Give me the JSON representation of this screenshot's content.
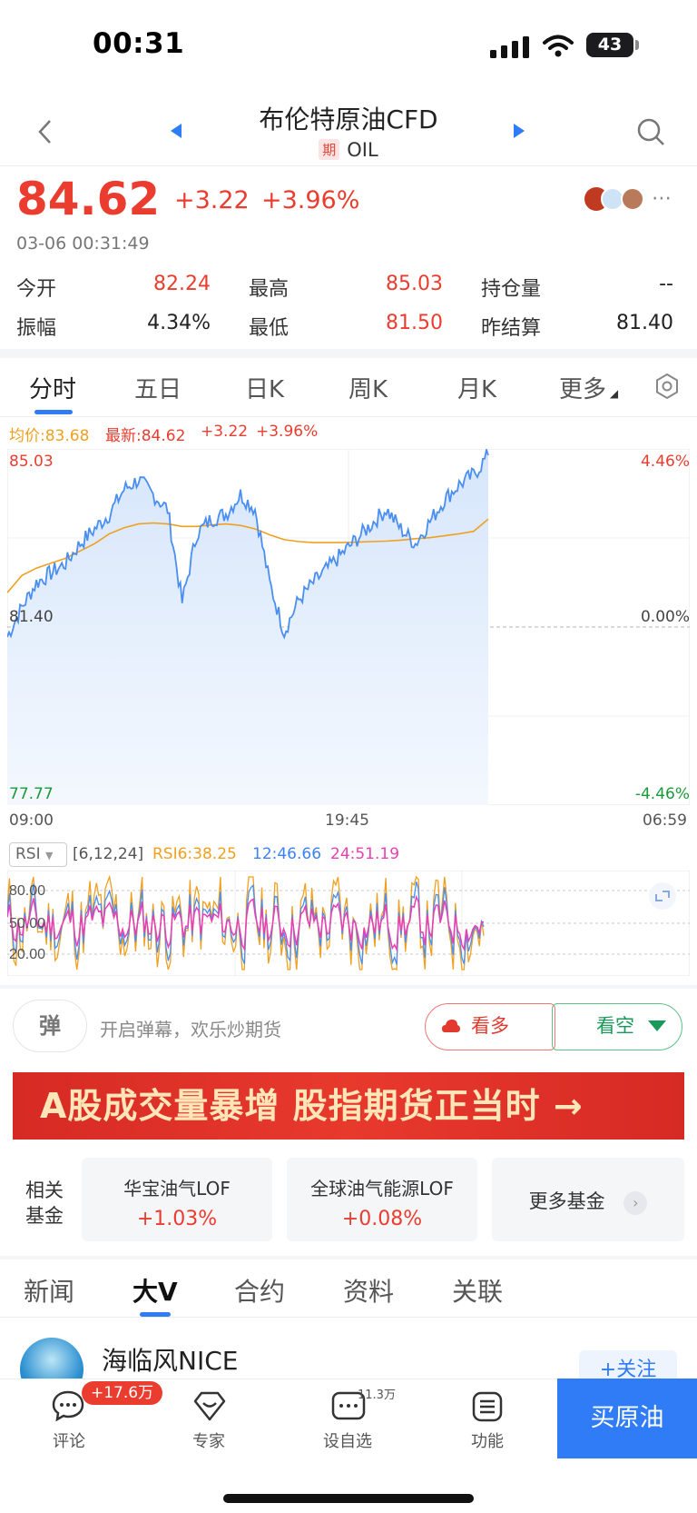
{
  "status_bar": {
    "time": "00:31",
    "battery": "43"
  },
  "header": {
    "title": "布伦特原油CFD",
    "badge": "期",
    "symbol": "OIL"
  },
  "quote": {
    "price": "84.62",
    "change": "+3.22",
    "change_pct": "+3.96%",
    "timestamp": "03-06 00:31:49",
    "stats": [
      {
        "label": "今开",
        "value": "82.24",
        "color": "red"
      },
      {
        "label": "最高",
        "value": "85.03",
        "color": "red"
      },
      {
        "label": "持仓量",
        "value": "--",
        "color": "dark"
      },
      {
        "label": "振幅",
        "value": "4.34%",
        "color": "dark"
      },
      {
        "label": "最低",
        "value": "81.50",
        "color": "red"
      },
      {
        "label": "昨结算",
        "value": "81.40",
        "color": "dark"
      }
    ]
  },
  "chart_tabs": [
    "分时",
    "五日",
    "日K",
    "周K",
    "月K",
    "更多"
  ],
  "chart_legend": {
    "avg": "均价:83.68",
    "latest": "最新:84.62",
    "change": "+3.22",
    "change_pct": "+3.96%"
  },
  "chart_axes": {
    "y_top": "85.03",
    "y_mid": "81.40",
    "y_bottom": "77.77",
    "pct_top": "4.46%",
    "pct_mid": "0.00%",
    "pct_bottom": "-4.46%",
    "x_start": "09:00",
    "x_mid": "19:45",
    "x_end": "06:59"
  },
  "chart_data": [
    {
      "type": "line",
      "series": [
        {
          "name": "最新",
          "values": [
            81.2,
            81.8,
            82.3,
            82.5,
            82.7,
            83.1,
            83.4,
            83.7,
            84.2,
            84.4,
            84.1,
            83.8,
            81.9,
            83.3,
            83.6,
            83.7,
            84.1,
            83.8,
            82.3,
            81.3,
            81.95,
            82.3,
            82.6,
            82.9,
            83.2,
            83.5,
            83.8,
            83.4,
            83.1,
            83.55,
            84.0,
            84.3,
            84.5,
            84.9
          ]
        },
        {
          "name": "均价",
          "values": [
            82.1,
            82.45,
            82.6,
            82.7,
            82.8,
            82.95,
            83.1,
            83.3,
            83.42,
            83.5,
            83.52,
            83.5,
            83.45,
            83.45,
            83.48,
            83.5,
            83.47,
            83.4,
            83.28,
            83.18,
            83.14,
            83.12,
            83.12,
            83.12,
            83.13,
            83.14,
            83.15,
            83.17,
            83.2,
            83.22,
            83.26,
            83.3,
            83.35,
            83.6
          ]
        }
      ],
      "ylim": [
        77.77,
        85.03
      ]
    },
    {
      "type": "line",
      "title": "RSI",
      "params": "[6,12,24]",
      "labels": [
        "RSI6:38.25",
        "12:46.66",
        "24:51.19"
      ],
      "series": [
        {
          "name": "RSI6",
          "last": 38.25
        },
        {
          "name": "12",
          "last": 46.66
        },
        {
          "name": "24",
          "last": 51.19
        }
      ],
      "grid_labels": [
        "80.00",
        "50.00",
        "20.00"
      ],
      "ylim": [
        0,
        100
      ]
    }
  ],
  "danmu": {
    "icon": "弹",
    "text": "开启弹幕，欢乐炒期货",
    "bull": "看多",
    "bear": "看空"
  },
  "banner": {
    "text": "A股成交量暴增  股指期货正当时 →"
  },
  "funds": {
    "label": "相关\n基金",
    "items": [
      {
        "name": "华宝油气LOF",
        "pct": "+1.03%"
      },
      {
        "name": "全球油气能源LOF",
        "pct": "+0.08%"
      }
    ],
    "more": "更多基金"
  },
  "news_tabs": [
    "新闻",
    "大V",
    "合约",
    "资料",
    "关联"
  ],
  "feed": {
    "author": "海临风NICE",
    "follow": "+关注"
  },
  "bottom": {
    "comment": "评论",
    "comment_badge": "+17.6万",
    "expert": "专家",
    "watch": "设自选",
    "watch_count": "11.3万",
    "func": "功能",
    "buy": "买原油"
  },
  "colors": {
    "up": "#ea3d2f",
    "down": "#1a9a3a",
    "accent": "#2f7cf6",
    "avg_line": "#f0a020",
    "rsi12": "#3b82f6",
    "rsi24": "#ea3fb0"
  }
}
